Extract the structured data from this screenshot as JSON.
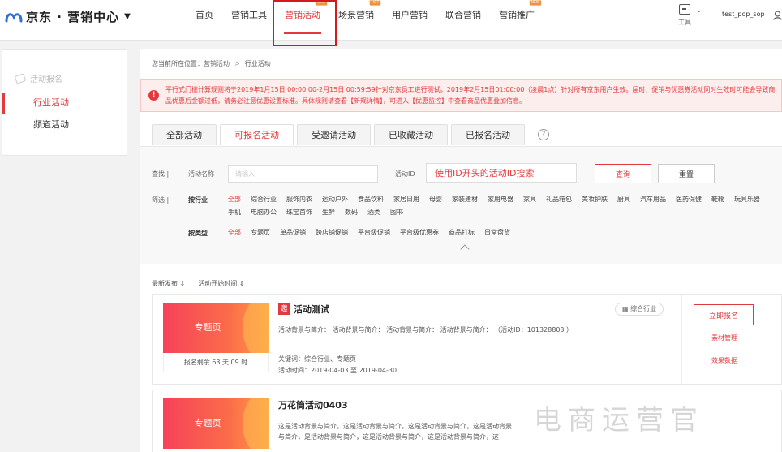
{
  "brand": {
    "name": "京东 · 营销中心",
    "caret": "▼"
  },
  "nav": {
    "items": [
      {
        "label": "首页",
        "badge": ""
      },
      {
        "label": "营销工具",
        "badge": ""
      },
      {
        "label": "营销活动",
        "badge": "NEW"
      },
      {
        "label": "场景营销",
        "badge": "HOT"
      },
      {
        "label": "用户营销",
        "badge": ""
      },
      {
        "label": "联合营销",
        "badge": ""
      },
      {
        "label": "营销推广",
        "badge": "NEW"
      }
    ]
  },
  "header": {
    "tools_label": "工具",
    "tools_caret": "⌄",
    "username": "test_pop_sop"
  },
  "sidebar": {
    "heading": "活动报名",
    "items": [
      {
        "label": "行业活动"
      },
      {
        "label": "频道活动"
      }
    ]
  },
  "breadcrumb": {
    "prefix": "您当前所在位置：营销活动",
    "sep": ">",
    "current": "行业活动"
  },
  "notice": {
    "icon": "!",
    "text": "平行式门槛计算规则将于2019年1月15日 00:00:00-2月15日 00:59:59针对京东员工进行测试。2019年2月15日01:00:00（凌晨1点）针对所有京东用户生效。届时，促销与优惠券活动同时生效时可能会导致商品优惠后金额过低，请务必注意优惠设置标准。具体规则请查看【新规详情】，可进入【优惠监控】中查看商品优惠叠加信息。"
  },
  "tabs": [
    {
      "label": "全部活动"
    },
    {
      "label": "可报名活动"
    },
    {
      "label": "受邀请活动"
    },
    {
      "label": "已收藏活动"
    },
    {
      "label": "已报名活动"
    }
  ],
  "help_icon": "?",
  "search": {
    "find_label": "查找 |",
    "name_label": "活动名称",
    "name_placeholder": "请输入",
    "id_label": "活动ID",
    "id_value": "使用ID开头的活动ID搜索",
    "query_label": "查询",
    "reset_label": "重置"
  },
  "filter": {
    "filter_label": "筛选 |",
    "industry_title": "按行业",
    "industries": [
      "全部",
      "综合行业",
      "服饰内衣",
      "运动户外",
      "食品饮料",
      "家居日用",
      "母婴",
      "家装建材",
      "家用电器",
      "家具",
      "礼品箱包",
      "美妆护肤",
      "厨具",
      "汽车用品",
      "医药保健",
      "鞋靴",
      "玩具乐器",
      "手机",
      "电脑办公",
      "珠宝首饰",
      "生鲜",
      "数码",
      "酒类",
      "图书"
    ],
    "type_title": "按类型",
    "types": [
      "全部",
      "专题页",
      "单品促销",
      "跨店铺促销",
      "平台级促销",
      "平台级优惠券",
      "商品打标",
      "日常盘货"
    ]
  },
  "sort": {
    "latest": "最新发布 ⇕",
    "start_time": "活动开始时间 ⇕"
  },
  "activities": [
    {
      "banner": "专题页",
      "remaining": "报名剩余 63 天 09 时",
      "badge": "邀",
      "title": "活动测试",
      "desc": "活动背景与简介： 活动背景与简介： 活动背景与简介： 活动背景与简介： （活动ID：101328803 ）",
      "keywords": "关键词：综合行业、专题页",
      "time": "活动时间：2019-04-03 至 2019-04-30",
      "industry": "综合行业",
      "join_label": "立即报名",
      "material_label": "素材管理",
      "effect_label": "效果数据"
    },
    {
      "banner": "专题页",
      "title": "万花筒活动0403",
      "desc": "这是活动背景与简介，这是活动背景与简介，这是活动背景与简介，这是活动背景与简介，是活动背景与简介，这是活动背景与简介，这是活动背景与简介，这"
    }
  ],
  "watermark": "电商运营官",
  "colors": {
    "accent": "#e4393c",
    "notice_bg": "#fdeeee",
    "banner_start": "#f7425a",
    "banner_end": "#fd9b46"
  }
}
